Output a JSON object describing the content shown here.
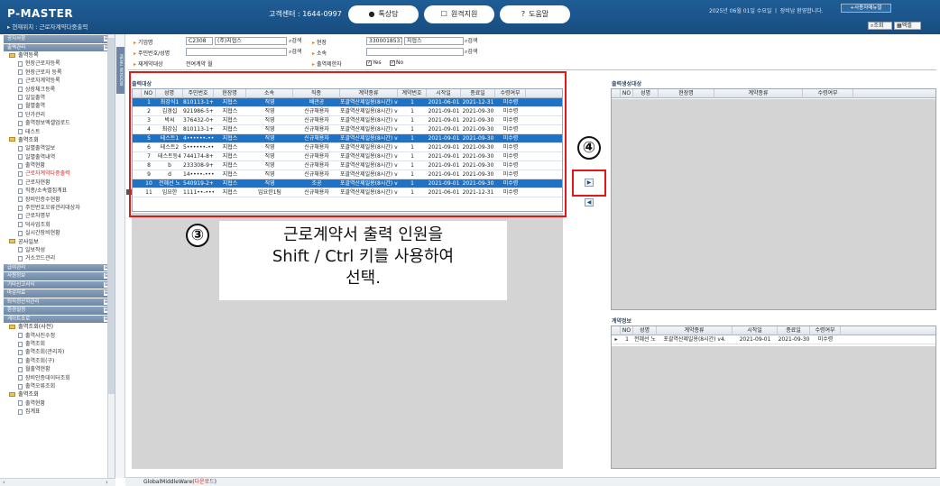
{
  "header": {
    "brand": "P-MASTER",
    "breadcrumb": "▸ 현재위치 : 근로자계약다중출력",
    "cc_label": "고객센터 : 1644-0997",
    "btn_chat": "톡상담",
    "btn_remote": "원격지원",
    "btn_help": "도움말",
    "chat_icon": "speech-bubble-icon",
    "remote_icon": "phone-icon",
    "help_icon": "question-icon",
    "date_text": "2025년 06월 01일 수요일 ㅣ 장비남 환영합니다.",
    "sitemap": "+사용자매뉴얼"
  },
  "tools": {
    "search": "조회",
    "excel": "엑셀"
  },
  "nav": [
    {
      "t": "sec",
      "label": "공지사항"
    },
    {
      "t": "sec",
      "label": "출역관리"
    },
    {
      "t": "fold",
      "label": "출역등록"
    },
    {
      "t": "item",
      "label": "현장근로자등록"
    },
    {
      "t": "item",
      "label": "현장근로자 등록"
    },
    {
      "t": "item",
      "label": "근로자계약등록"
    },
    {
      "t": "item",
      "label": "상장체크등록"
    },
    {
      "t": "item",
      "label": "일일출역"
    },
    {
      "t": "item",
      "label": "월별출역"
    },
    {
      "t": "item",
      "label": "단가관리"
    },
    {
      "t": "item",
      "label": "출역정보엑셀업로드"
    },
    {
      "t": "item",
      "label": "테스트"
    },
    {
      "t": "fold",
      "label": "출역조회"
    },
    {
      "t": "item",
      "label": "일별출역일보"
    },
    {
      "t": "item",
      "label": "일별출역내역"
    },
    {
      "t": "item",
      "label": "출역현황"
    },
    {
      "t": "item",
      "label": "근로자계약다중출력",
      "red": true
    },
    {
      "t": "item",
      "label": "근로자현황"
    },
    {
      "t": "item",
      "label": "직종/소속별집계표"
    },
    {
      "t": "item",
      "label": "장비인증수현황"
    },
    {
      "t": "item",
      "label": "주민번호오류관리대상자"
    },
    {
      "t": "item",
      "label": "근로자명부"
    },
    {
      "t": "item",
      "label": "덕사업조회"
    },
    {
      "t": "item",
      "label": "실시간장비현황"
    },
    {
      "t": "fold",
      "label": "공사일보"
    },
    {
      "t": "item",
      "label": "일보작성"
    },
    {
      "t": "item",
      "label": "거소코드관리"
    },
    {
      "t": "sec",
      "label": "급여관리"
    },
    {
      "t": "sec",
      "label": "사원정보"
    },
    {
      "t": "sec",
      "label": "기타신고서식"
    },
    {
      "t": "sec",
      "label": "마감자료"
    },
    {
      "t": "sec",
      "label": "퇴직정산자관리"
    },
    {
      "t": "sec",
      "label": "환경설정"
    },
    {
      "t": "sec",
      "label": "게이트조로"
    },
    {
      "t": "fold",
      "label": "출역조회(사전)"
    },
    {
      "t": "item",
      "label": "출역사진수정"
    },
    {
      "t": "item",
      "label": "출역조회"
    },
    {
      "t": "item",
      "label": "출역조회(관리자)"
    },
    {
      "t": "item",
      "label": "출역조회(구)"
    },
    {
      "t": "item",
      "label": "월출역현황"
    },
    {
      "t": "item",
      "label": "장비인증데이터조회"
    },
    {
      "t": "item",
      "label": "출역오류조회"
    },
    {
      "t": "fold",
      "label": "출역조회"
    },
    {
      "t": "item",
      "label": "출역현황"
    },
    {
      "t": "item",
      "label": "집계표"
    }
  ],
  "menu_tab": "MENU WINDOW",
  "form": {
    "company_label": "기업명",
    "company_code": "C2308",
    "company_name": "(주)지협스",
    "search_btn": "검색",
    "site_label": "현장",
    "site_code": "3300018537",
    "site_name": "지협스",
    "rrn_label": "주민번호/성명",
    "dept_label": "소속",
    "contract_label": "재계약대상",
    "contract_value": "전여계약  월",
    "print_label": "출역제한자",
    "yes_label": "Yes",
    "no_label": "No"
  },
  "grid_left": {
    "title": "출력대상",
    "columns": [
      "NO",
      "성명",
      "주민번호",
      "현장명",
      "소속",
      "직종",
      "계약종류",
      "계약번호",
      "시작일",
      "종료일",
      "수령여부"
    ],
    "rows": [
      {
        "sel": true,
        "cells": [
          "1",
          "최강식1",
          "810113-1+",
          "지협스",
          "직영",
          "배관공",
          "포괄역산제일용(8시간) v4.",
          "1",
          "2021-06-01",
          "2021-12-31",
          "미수령"
        ]
      },
      {
        "sel": false,
        "cells": [
          "2",
          "김경섭",
          "921986-5+",
          "지협스",
          "직영",
          "신규채용자",
          "포괄역산제일용(8시간) v4.",
          "1",
          "2021-09-01",
          "2021-09-30",
          "미수령"
        ]
      },
      {
        "sel": false,
        "cells": [
          "3",
          "박씨",
          "376432-0+",
          "지협스",
          "직영",
          "신규채용자",
          "포괄역산제일용(8시간) v4.",
          "1",
          "2021-09-01",
          "2021-09-30",
          "미수령"
        ]
      },
      {
        "sel": false,
        "cells": [
          "4",
          "최강심",
          "810113-1+",
          "지협스",
          "직영",
          "신규채용자",
          "포괄역산제일용(8시간) v4.",
          "1",
          "2021-09-01",
          "2021-09-30",
          "미수령"
        ]
      },
      {
        "sel": true,
        "cells": [
          "5",
          "테스트1",
          "4••••••-•••",
          "지협스",
          "직영",
          "신규채용자",
          "포괄역산제일용(8시간) v4.",
          "1",
          "2021-09-01",
          "2021-09-30",
          "미수령"
        ]
      },
      {
        "sel": false,
        "cells": [
          "6",
          "테스트2",
          "5••••••-•••",
          "지협스",
          "직영",
          "신규채용자",
          "포괄역산제일용(8시간) v4.",
          "1",
          "2021-09-01",
          "2021-09-30",
          "미수령"
        ]
      },
      {
        "sel": false,
        "cells": [
          "7",
          "테스트등4",
          "744174-8+",
          "지협스",
          "직영",
          "신규채용자",
          "포괄역산제일용(8시간) v4.",
          "1",
          "2021-09-01",
          "2021-09-30",
          "미수령"
        ]
      },
      {
        "sel": false,
        "cells": [
          "8",
          "b",
          "233308-9+",
          "지협스",
          "직영",
          "신규채용자",
          "포괄역산제일용(8시간) v4.",
          "1",
          "2021-09-01",
          "2021-09-30",
          "미수령"
        ]
      },
      {
        "sel": false,
        "cells": [
          "9",
          "d",
          "14••••-•••",
          "지협스",
          "직영",
          "신규채용자",
          "포괄역산제일용(8시간) v4.",
          "1",
          "2021-09-01",
          "2021-09-30",
          "미수령"
        ]
      },
      {
        "sel": true,
        "cells": [
          "10",
          "전혜선 노",
          "540919-2+",
          "지협스",
          "직영",
          "조공",
          "포괄역산제일용(8시간) v4.",
          "1",
          "2021-09-01",
          "2021-09-30",
          "미수령"
        ]
      },
      {
        "sel": false,
        "cells": [
          "11",
          "임요한",
          "1111••-•••",
          "지협스",
          "임요한1팀",
          "신규채용자",
          "포괄역산제일용(8시간) v4.",
          "1",
          "2021-06-01",
          "2021-12-31",
          "미수령"
        ]
      }
    ]
  },
  "grid_right": {
    "title": "출력생성대상",
    "columns": [
      "NO",
      "성명",
      "현장명",
      "계약종류",
      "수령여부"
    ]
  },
  "grid_contract": {
    "title": "계약정보",
    "columns": [
      "NO",
      "성명",
      "계약종류",
      "시작일",
      "종료일",
      "수령여부"
    ],
    "rows": [
      {
        "cells": [
          "1",
          "전혜선 노",
          "포괄역산제일용(8시간) v4.",
          "2021-09-01",
          "2021-09-30",
          "미수령"
        ]
      }
    ]
  },
  "annotations": {
    "step3": "③",
    "step4": "④",
    "caption_line1": "근로계약서 출력 인원을",
    "caption_line2": "Shift / Ctrl 키를 사용하여",
    "caption_line3": "선택.",
    "highlight_color": "#e01818"
  },
  "arrows": {
    "right": "▶",
    "left": "◀"
  },
  "status": {
    "prefix": "GlobalMiddleWare(",
    "link": "다운로드",
    "suffix": ")"
  },
  "colors": {
    "header": "#1f5d96",
    "selected_row": "#1f73c7",
    "active_menu": "#d9261c"
  }
}
